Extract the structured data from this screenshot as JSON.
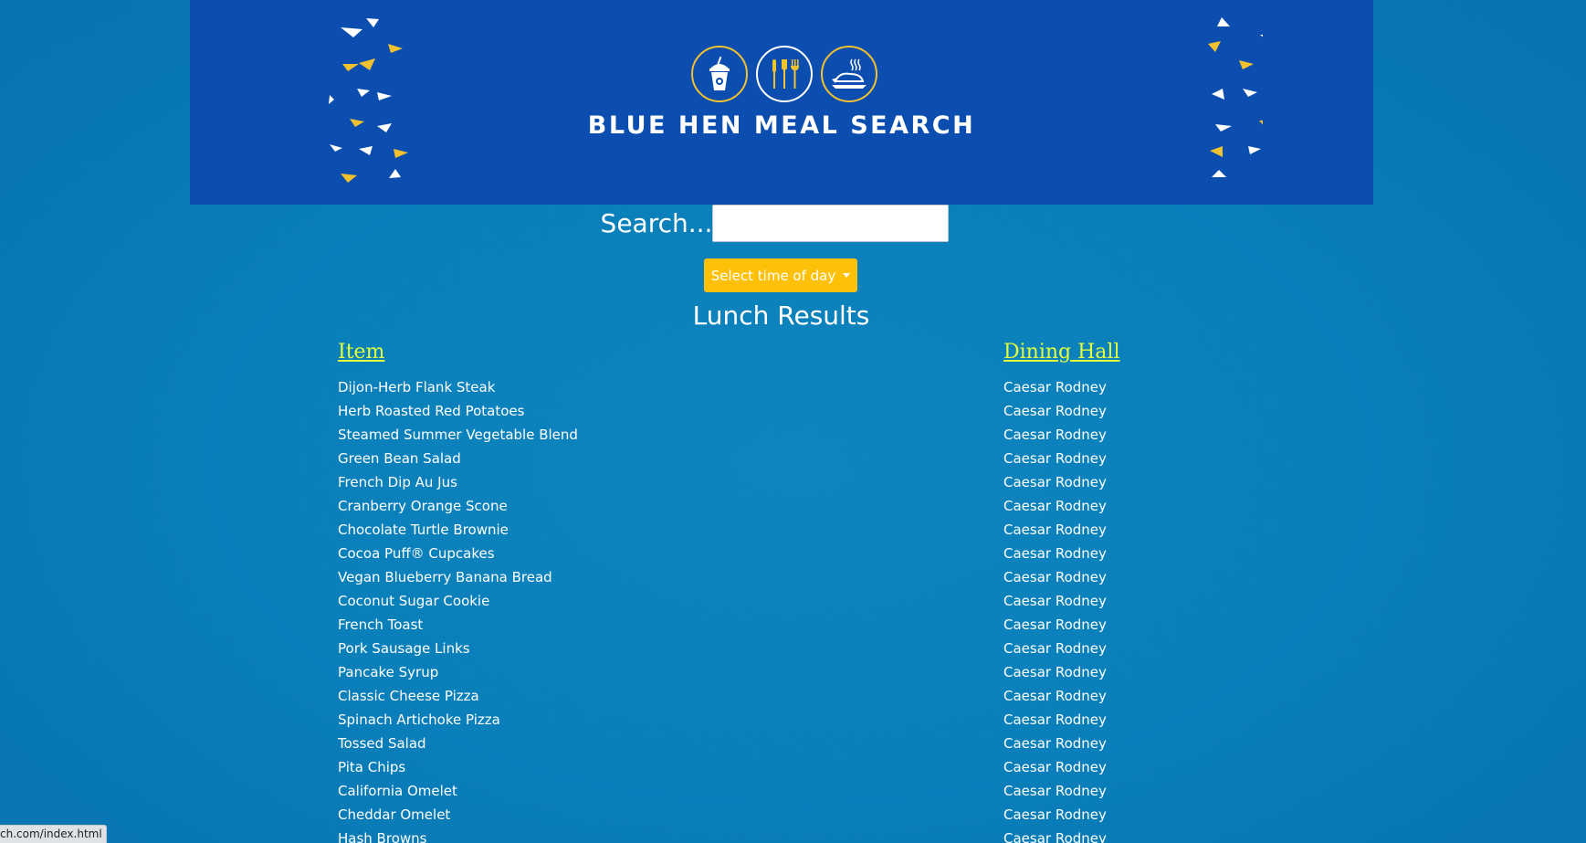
{
  "header": {
    "title": "BLUE HEN MEAL SEARCH",
    "icons": [
      "drink-cup-icon",
      "utensils-icon",
      "roast-chicken-icon"
    ],
    "colors": {
      "banner": "#0b4eb0",
      "accent": "#f2c12e"
    }
  },
  "search": {
    "label": "Search...",
    "value": "",
    "placeholder": ""
  },
  "time_dropdown": {
    "label": "Select time of day"
  },
  "results": {
    "title": "Lunch Results",
    "columns": {
      "item": "Item",
      "hall": "Dining Hall"
    },
    "rows": [
      {
        "item": "Dijon-Herb Flank Steak",
        "hall": "Caesar Rodney"
      },
      {
        "item": "Herb Roasted Red Potatoes",
        "hall": "Caesar Rodney"
      },
      {
        "item": "Steamed Summer Vegetable Blend",
        "hall": "Caesar Rodney"
      },
      {
        "item": "Green Bean Salad",
        "hall": "Caesar Rodney"
      },
      {
        "item": "French Dip Au Jus",
        "hall": "Caesar Rodney"
      },
      {
        "item": "Cranberry Orange Scone",
        "hall": "Caesar Rodney"
      },
      {
        "item": "Chocolate Turtle Brownie",
        "hall": "Caesar Rodney"
      },
      {
        "item": "Cocoa Puff® Cupcakes",
        "hall": "Caesar Rodney"
      },
      {
        "item": "Vegan Blueberry Banana Bread",
        "hall": "Caesar Rodney"
      },
      {
        "item": "Coconut Sugar Cookie",
        "hall": "Caesar Rodney"
      },
      {
        "item": "French Toast",
        "hall": "Caesar Rodney"
      },
      {
        "item": "Pork Sausage Links",
        "hall": "Caesar Rodney"
      },
      {
        "item": "Pancake Syrup",
        "hall": "Caesar Rodney"
      },
      {
        "item": "Classic Cheese Pizza",
        "hall": "Caesar Rodney"
      },
      {
        "item": "Spinach Artichoke Pizza",
        "hall": "Caesar Rodney"
      },
      {
        "item": "Tossed Salad",
        "hall": "Caesar Rodney"
      },
      {
        "item": "Pita Chips",
        "hall": "Caesar Rodney"
      },
      {
        "item": "California Omelet",
        "hall": "Caesar Rodney"
      },
      {
        "item": "Cheddar Omelet",
        "hall": "Caesar Rodney"
      },
      {
        "item": "Hash Browns",
        "hall": "Caesar Rodney"
      }
    ]
  },
  "status_bar": {
    "url": "ch.com/index.html"
  }
}
